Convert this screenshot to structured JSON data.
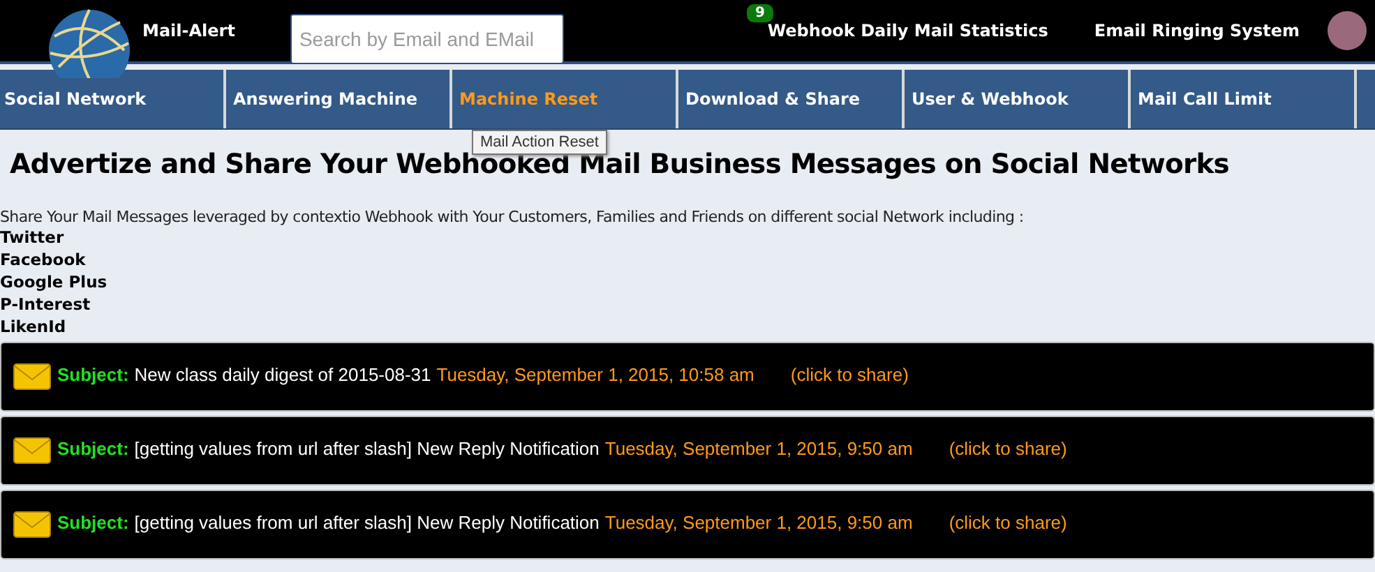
{
  "header": {
    "brand": "Mail-Alert",
    "search": {
      "placeholder": "Search by Email and EMail"
    },
    "badge": "9",
    "links": [
      "Webhook Daily Mail Statistics",
      "Email Ringing System"
    ]
  },
  "nav": [
    {
      "label": "Social Network",
      "selected": false
    },
    {
      "label": "Answering Machine",
      "selected": false
    },
    {
      "label": "Machine Reset",
      "selected": true
    },
    {
      "label": "Download & Share",
      "selected": false
    },
    {
      "label": "User & Webhook",
      "selected": false
    },
    {
      "label": "Mail Call Limit",
      "selected": false
    }
  ],
  "tooltip": "Mail Action Reset",
  "heading": "Advertize and Share Your Webhooked Mail Business Messages on Social Networks",
  "intro": "Share Your Mail Messages leveraged by contextio Webhook with Your Customers, Families and Friends on different social Network including :",
  "networks": [
    "Twitter",
    "Facebook",
    "Google Plus",
    "P-Interest",
    "LikenId"
  ],
  "messages": [
    {
      "label": "Subject:",
      "subject": "New class daily digest of 2015-08-31",
      "date": "Tuesday, September 1, 2015, 10:58 am",
      "action": "(click to share)"
    },
    {
      "label": "Subject:",
      "subject": "[getting values from url after slash] New Reply Notification",
      "date": "Tuesday, September 1, 2015, 9:50 am",
      "action": "(click to share)"
    },
    {
      "label": "Subject:",
      "subject": "[getting values from url after slash] New Reply Notification",
      "date": "Tuesday, September 1, 2015, 9:50 am",
      "action": "(click to share)"
    }
  ]
}
